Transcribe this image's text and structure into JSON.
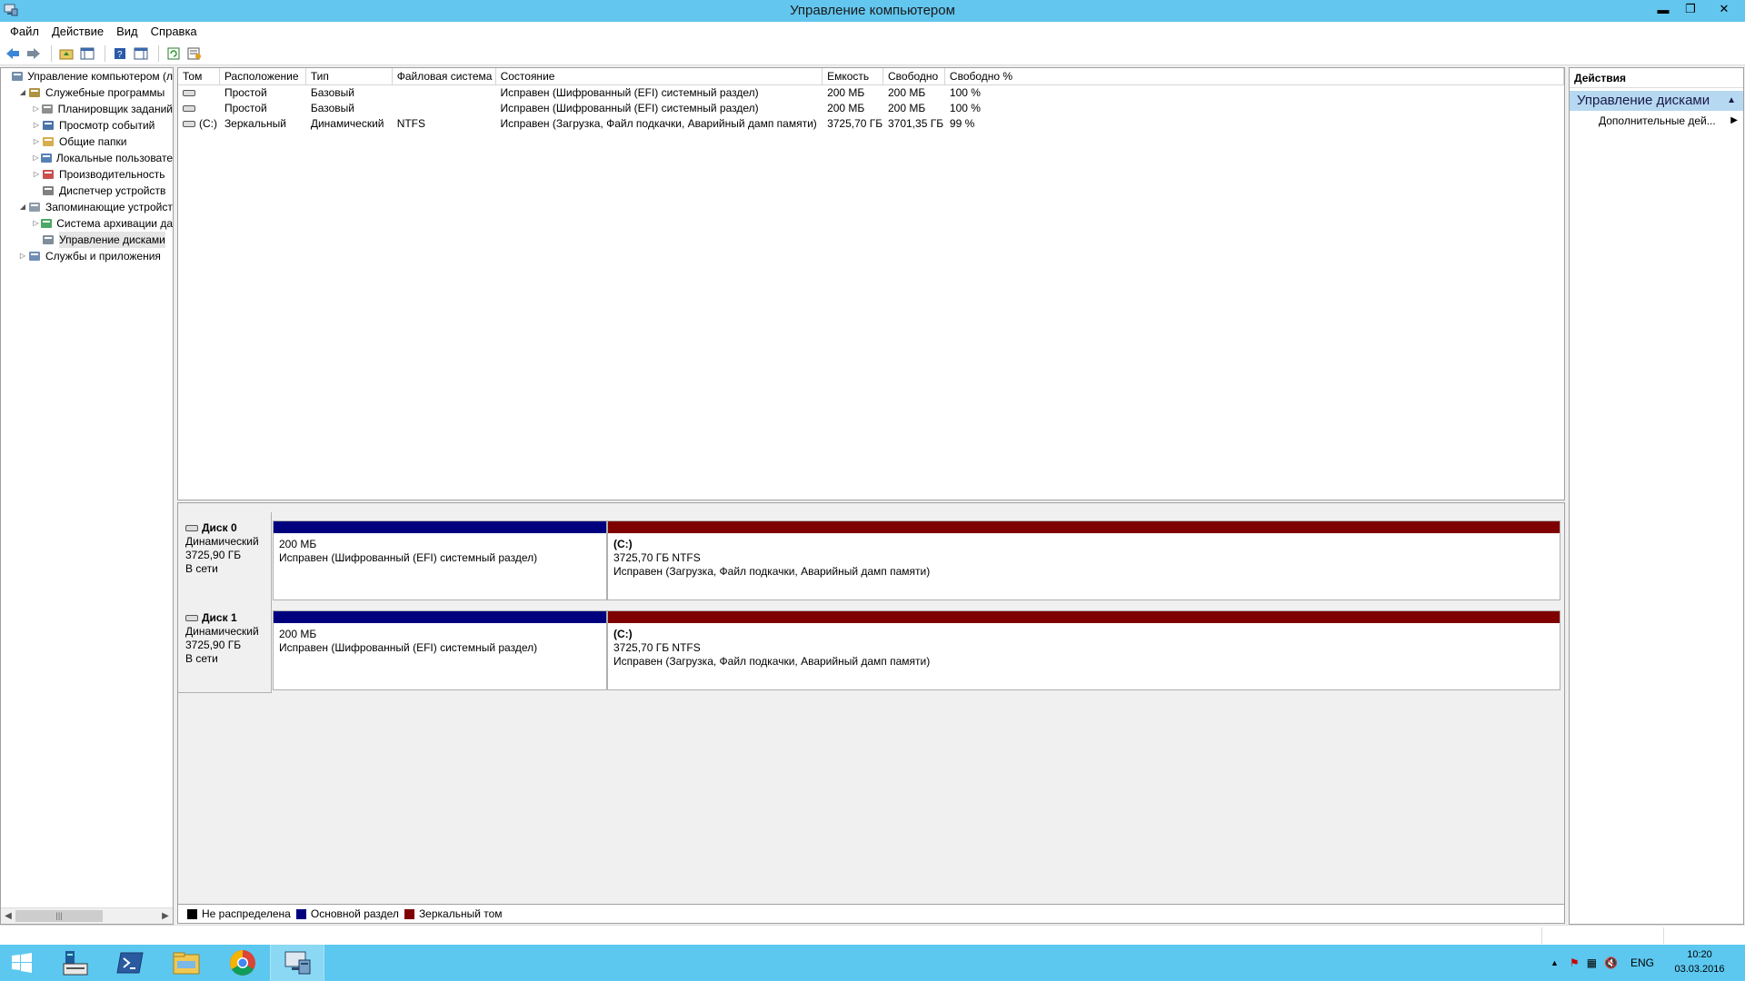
{
  "window": {
    "title": "Управление компьютером",
    "min": "▬",
    "max": "❐",
    "close": "✕"
  },
  "menu": [
    "Файл",
    "Действие",
    "Вид",
    "Справка"
  ],
  "tree": [
    {
      "label": "Управление компьютером (л",
      "depth": 0,
      "exp": "",
      "icon": "computer-management-icon"
    },
    {
      "label": "Служебные программы",
      "depth": 1,
      "exp": "◢",
      "icon": "tools-icon"
    },
    {
      "label": "Планировщик заданий",
      "depth": 2,
      "exp": "▷",
      "icon": "clock-icon"
    },
    {
      "label": "Просмотр событий",
      "depth": 2,
      "exp": "▷",
      "icon": "event-viewer-icon"
    },
    {
      "label": "Общие папки",
      "depth": 2,
      "exp": "▷",
      "icon": "shared-folder-icon"
    },
    {
      "label": "Локальные пользовате",
      "depth": 2,
      "exp": "▷",
      "icon": "users-icon"
    },
    {
      "label": "Производительность",
      "depth": 2,
      "exp": "▷",
      "icon": "performance-icon"
    },
    {
      "label": "Диспетчер устройств",
      "depth": 2,
      "exp": "",
      "icon": "device-manager-icon"
    },
    {
      "label": "Запоминающие устройст",
      "depth": 1,
      "exp": "◢",
      "icon": "storage-icon"
    },
    {
      "label": "Система архивации да",
      "depth": 2,
      "exp": "▷",
      "icon": "backup-icon"
    },
    {
      "label": "Управление дисками",
      "depth": 2,
      "exp": "",
      "icon": "disk-management-icon",
      "selected": true
    },
    {
      "label": "Службы и приложения",
      "depth": 1,
      "exp": "▷",
      "icon": "services-icon"
    }
  ],
  "volumes": {
    "headers": [
      "Том",
      "Расположение",
      "Тип",
      "Файловая система",
      "Состояние",
      "Емкость",
      "Свободно",
      "Свободно %"
    ],
    "rows": [
      {
        "tom": "",
        "loc": "Простой",
        "type": "Базовый",
        "fs": "",
        "state": "Исправен (Шифрованный (EFI) системный раздел)",
        "cap": "200 МБ",
        "free": "200 МБ",
        "freep": "100 %"
      },
      {
        "tom": "",
        "loc": "Простой",
        "type": "Базовый",
        "fs": "",
        "state": "Исправен (Шифрованный (EFI) системный раздел)",
        "cap": "200 МБ",
        "free": "200 МБ",
        "freep": "100 %"
      },
      {
        "tom": "(C:)",
        "loc": "Зеркальный",
        "type": "Динамический",
        "fs": "NTFS",
        "state": "Исправен (Загрузка, Файл подкачки, Аварийный дамп памяти)",
        "cap": "3725,70 ГБ",
        "free": "3701,35 ГБ",
        "freep": "99 %"
      }
    ]
  },
  "disks": [
    {
      "name": "Диск 0",
      "kind": "Динамический",
      "size": "3725,90 ГБ",
      "status": "В сети",
      "p1": {
        "name": "",
        "size": "200 МБ",
        "state": "Исправен (Шифрованный (EFI) системный раздел)"
      },
      "p2": {
        "name": "(C:)",
        "size": "3725,70 ГБ NTFS",
        "state": "Исправен (Загрузка, Файл подкачки, Аварийный дамп памяти)"
      }
    },
    {
      "name": "Диск 1",
      "kind": "Динамический",
      "size": "3725,90 ГБ",
      "status": "В сети",
      "p1": {
        "name": "",
        "size": "200 МБ",
        "state": "Исправен (Шифрованный (EFI) системный раздел)"
      },
      "p2": {
        "name": "(C:)",
        "size": "3725,70 ГБ NTFS",
        "state": "Исправен (Загрузка, Файл подкачки, Аварийный дамп памяти)"
      }
    }
  ],
  "legend": [
    {
      "label": "Не распределена",
      "color": "#000000"
    },
    {
      "label": "Основной раздел",
      "color": "#00007f"
    },
    {
      "label": "Зеркальный том",
      "color": "#7f0000"
    }
  ],
  "actions": {
    "header": "Действия",
    "section": "Управление дисками",
    "more": "Дополнительные дей..."
  },
  "taskbar": {
    "lang": "ENG",
    "time": "10:20",
    "date": "03.03.2016"
  },
  "colors": {
    "primary": "#00007f",
    "mirror": "#7f0000",
    "titlebar": "#63c6ee",
    "taskbar": "#5cc8ef"
  }
}
